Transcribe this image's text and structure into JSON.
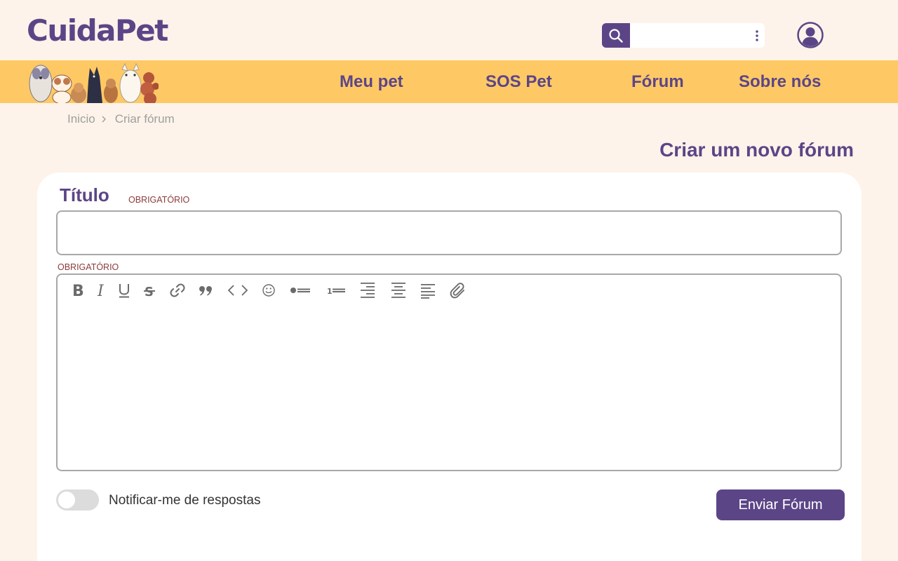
{
  "app": {
    "logo": "CuidaPet"
  },
  "header": {
    "search_placeholder": "",
    "search_icon": "search-icon",
    "menu_icon": "kebab-menu-icon",
    "user_icon": "user-profile-icon"
  },
  "nav": {
    "items": [
      "Meu pet",
      "SOS Pet",
      "Fórum",
      "Sobre nós"
    ]
  },
  "breadcrumb": {
    "items": [
      "Inicio",
      "Criar fórum"
    ]
  },
  "page": {
    "title": "Criar um novo fórum"
  },
  "form": {
    "title_label": "Título",
    "title_required": "OBRIGATÓRIO",
    "title_value": "",
    "body_required": "OBRIGATÓRIO",
    "body_value": "",
    "toolbar": [
      "bold-icon",
      "italic-icon",
      "underline-icon",
      "strikethrough-icon",
      "link-icon",
      "quote-icon",
      "code-icon",
      "emoji-icon",
      "bullet-list-icon",
      "numbered-list-icon",
      "align-right-icon",
      "align-center-icon",
      "align-left-icon",
      "attachment-icon"
    ],
    "notify_label": "Notificar-me de respostas",
    "notify_on": false,
    "submit_label": "Enviar Fórum"
  },
  "colors": {
    "brand_purple": "#5c4587",
    "nav_yellow": "#fec965",
    "background": "#fdf3ea",
    "required_red": "#8d3b3b"
  }
}
